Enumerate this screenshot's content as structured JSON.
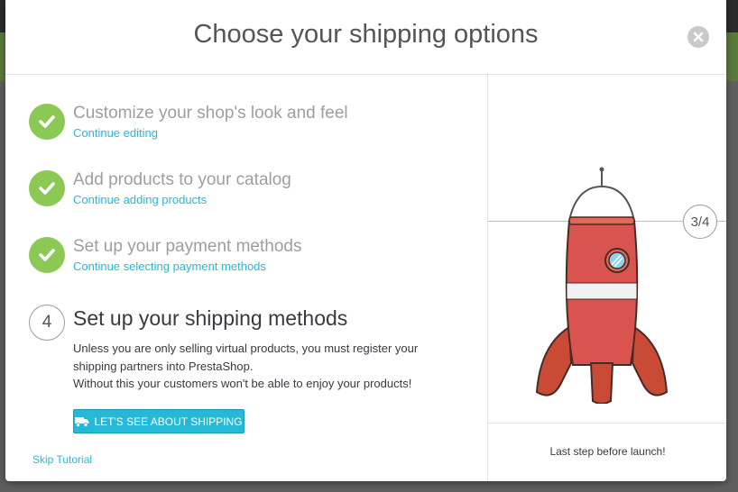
{
  "modal": {
    "title": "Choose your shipping options",
    "close_icon": "close-icon"
  },
  "steps": [
    {
      "status": "done",
      "title": "Customize your shop's look and feel",
      "link": "Continue editing"
    },
    {
      "status": "done",
      "title": "Add products to your catalog",
      "link": "Continue adding products"
    },
    {
      "status": "done",
      "title": "Set up your payment methods",
      "link": "Continue selecting payment methods"
    }
  ],
  "current_step": {
    "number": "4",
    "title": "Set up your shipping methods",
    "description": [
      "Unless you are only selling virtual products, you must register your",
      "shipping partners into PrestaShop.",
      "Without this your customers won't be able to enjoy your products!"
    ],
    "button_label": "LET'S SEE ABOUT SHIPPING",
    "button_icon": "truck-icon"
  },
  "skip_label": "Skip Tutorial",
  "progress": {
    "label": "3/4",
    "current": 3,
    "total": 4
  },
  "launch_text": "Last step before launch!",
  "colors": {
    "accent": "#25b9d7",
    "done": "#8bc954",
    "rocket": "#d9534f"
  }
}
